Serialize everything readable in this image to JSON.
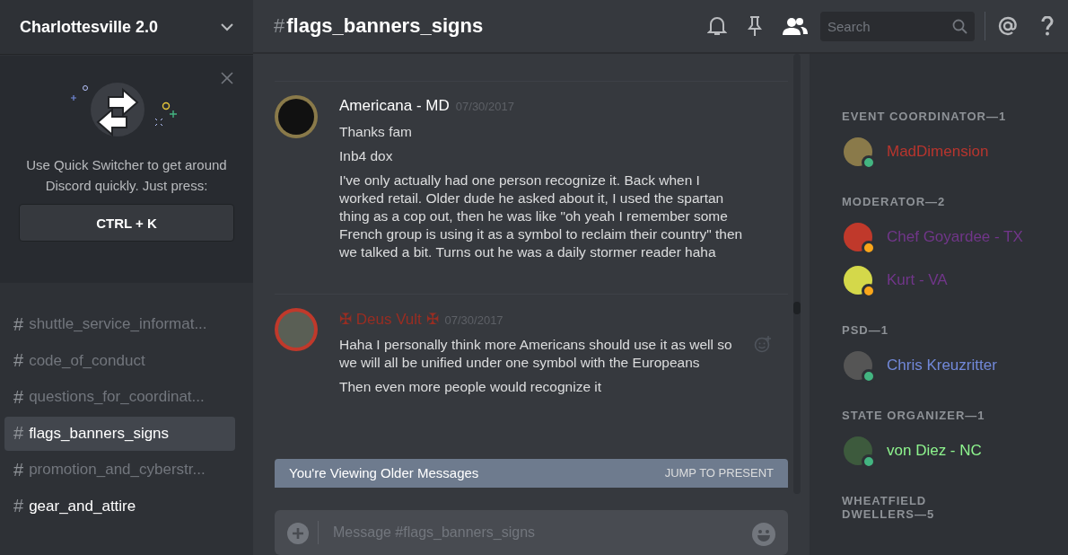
{
  "server": {
    "name": "Charlottesville 2.0"
  },
  "quick_switcher": {
    "text": "Use Quick Switcher to get around Discord quickly. Just press:",
    "shortcut": "CTRL + K"
  },
  "channels": [
    {
      "icon": "#",
      "name": "shuttle_service_informat...",
      "selected": false,
      "unread": false
    },
    {
      "icon": "#",
      "name": "code_of_conduct",
      "selected": false,
      "unread": false
    },
    {
      "icon": "#",
      "name": "questions_for_coordinat...",
      "selected": false,
      "unread": false
    },
    {
      "icon": "#",
      "name": "flags_banners_signs",
      "selected": true,
      "unread": true
    },
    {
      "icon": "#",
      "name": "promotion_and_cyberstr...",
      "selected": false,
      "unread": false
    },
    {
      "icon": "#",
      "name": "gear_and_attire",
      "selected": false,
      "unread": true
    }
  ],
  "channel_header": {
    "hash": "#",
    "name": "flags_banners_signs"
  },
  "search": {
    "placeholder": "Search"
  },
  "messages": [
    {
      "author": "Americana - MD",
      "color": "#ffffff",
      "timestamp": "07/30/2017",
      "lines": [
        "Thanks fam",
        "Inb4 dox",
        "I've only actually had one person recognize it. Back when I worked retail. Older dude he asked about it, I used the spartan thing as a cop out, then he was like \"oh yeah I remember some French group is using it as a symbol to reclaim their country\" then we talked a bit. Turns out he was a daily stormer reader haha"
      ]
    },
    {
      "author": "✠ Deus Vult ✠",
      "color": "#992d22",
      "timestamp": "07/30/2017",
      "lines": [
        "Haha I personally think more Americans should use it as well so we will all be unified under one symbol with the Europeans",
        "Then even more people would recognize it"
      ]
    }
  ],
  "older_banner": {
    "text": "You're Viewing Older Messages",
    "action": "JUMP TO PRESENT"
  },
  "composer": {
    "placeholder": "Message #flags_banners_signs"
  },
  "member_groups": [
    {
      "title": "EVENT COORDINATOR—1",
      "color": "#b8352e",
      "members": [
        {
          "name": "MadDimension",
          "color": "#43b581"
        }
      ]
    },
    {
      "title": "MODERATOR—2",
      "color": "#71368a",
      "members": [
        {
          "name": "Chef Goyardee - TX",
          "color": "#faa61a"
        },
        {
          "name": "Kurt - VA",
          "color": "#faa61a"
        }
      ]
    },
    {
      "title": "PSD—1",
      "color": "#7289da",
      "members": [
        {
          "name": "Chris Kreuzritter",
          "color": "#43b581"
        }
      ]
    },
    {
      "title": "STATE ORGANIZER—1",
      "color": "#8ef58e",
      "members": [
        {
          "name": "von Diez - NC",
          "color": "#43b581"
        }
      ]
    },
    {
      "title": "WHEATFIELD DWELLERS—5"
    }
  ]
}
